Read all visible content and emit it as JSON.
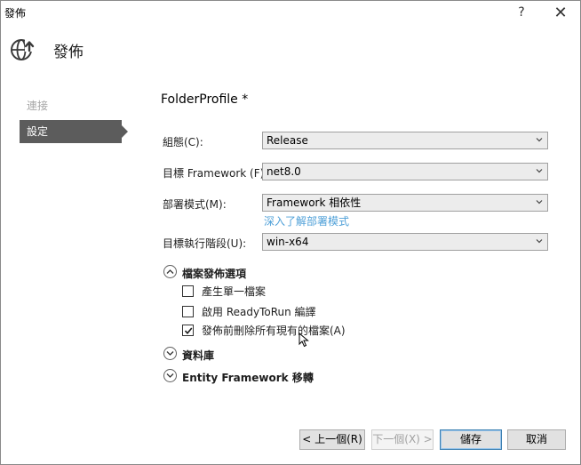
{
  "window": {
    "title": "發佈",
    "help": "?",
    "close": "✕"
  },
  "header": {
    "title": "發佈"
  },
  "nav": {
    "items": [
      {
        "label": "連接"
      },
      {
        "label": "設定"
      }
    ]
  },
  "profile": {
    "name": "FolderProfile *"
  },
  "fields": {
    "config": {
      "label": "組態(C):",
      "value": "Release"
    },
    "framework": {
      "label": "目標 Framework (F):",
      "value": "net8.0"
    },
    "deploy": {
      "label": "部署模式(M):",
      "value": "Framework 相依性",
      "link": "深入了解部署模式"
    },
    "runtime": {
      "label": "目標執行階段(U):",
      "value": "win-x64"
    }
  },
  "sections": {
    "file_publish": {
      "label": "檔案發佈選項",
      "expanded": true
    },
    "database": {
      "label": "資料庫",
      "expanded": false
    },
    "ef": {
      "label": "Entity Framework 移轉",
      "expanded": false
    }
  },
  "options": [
    {
      "label": "產生單一檔案",
      "checked": false
    },
    {
      "label": "啟用 ReadyToRun 編譯",
      "checked": false
    },
    {
      "label": "發佈前刪除所有現有的檔案(A)",
      "checked": true
    }
  ],
  "buttons": {
    "prev": "< 上一個(R)",
    "next": "下一個(X) >",
    "save": "儲存",
    "cancel": "取消"
  }
}
